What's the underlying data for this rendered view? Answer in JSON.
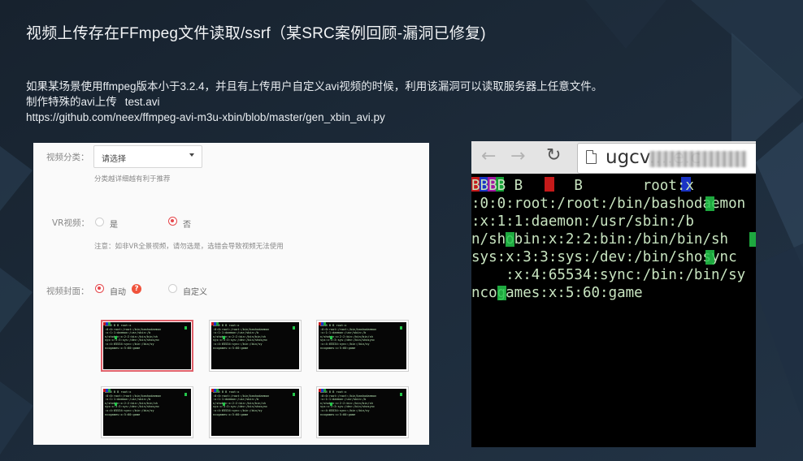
{
  "slide": {
    "title": "视频上传存在FFmpeg文件读取/ssrf（某SRC案例回顾-漏洞已修复)",
    "description_line1": "如果某场景使用ffmpeg版本小于3.2.4，并且有上传用户自定义avi视频的时候，利用该漏洞可以读取服务器上任意文件。",
    "description_line2": "制作特殊的avi上传",
    "file_name": "test.avi",
    "link": "https://github.com/neex/ffmpeg-avi-m3u-xbin/blob/master/gen_xbin_avi.py"
  },
  "form": {
    "category_label": "视频分类：",
    "category_select_value": "请选择",
    "category_hint": "分类越详细越有利于推荐",
    "vr_label": "VR视频：",
    "vr_options": [
      "是",
      "否"
    ],
    "vr_selected": "否",
    "vr_hint": "注意：如非VR全景视频，请勿选是，选错会导致视频无法使用",
    "cover_label": "视频封面：",
    "cover_options": [
      "自动",
      "自定义"
    ],
    "cover_selected": "自动",
    "help_icon": "?"
  },
  "browser": {
    "url_visible": "ugcv",
    "url_blurred_suffix": "....e.c",
    "terminal_lines": [
      "BBBB B      B       root:x",
      ":0:0:root:/root:/bin/bashodaemon",
      ":x:1:1:daemon:/usr/sbin:/b",
      "n/shobin:x:2:2:bin:/bin/bin/sh",
      "sys:x:3:3:sys:/dev:/bin/shosync",
      "    :x:4:65534:sync:/bin:/bin/sy",
      "ncogames:x:5:60:game"
    ]
  },
  "colors": {
    "background": "#1c2836",
    "highlight_green": "#23c64a",
    "radio_red": "#e5484d"
  }
}
